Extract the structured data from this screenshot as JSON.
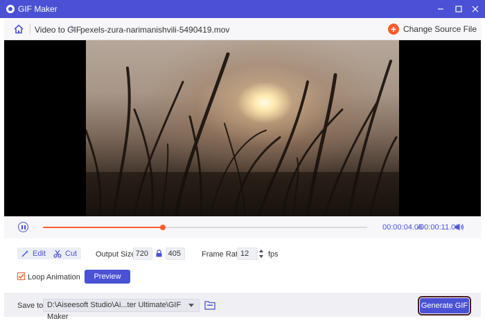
{
  "window": {
    "title": "GIF Maker"
  },
  "nav": {
    "crumb_root": "Video to GIF",
    "crumb_file": "pexels-zura-narimanishvili-5490419.mov",
    "change_source_label": "Change Source File"
  },
  "player": {
    "current_time": "00:00:04.06",
    "total_time": "/00:00:11.06",
    "progress_fraction": 0.37
  },
  "options": {
    "edit_label": "Edit",
    "cut_label": "Cut",
    "output_size_label": "Output Size:",
    "width_value": "720",
    "height_value": "405",
    "frame_rate_label": "Frame Rate:",
    "frame_rate_value": "12",
    "fps_unit": "fps",
    "loop_label": "Loop Animation",
    "loop_checked": true,
    "preview_label": "Preview"
  },
  "save": {
    "label": "Save to:",
    "path": "D:\\Aiseesoft Studio\\Ai...ter Ultimate\\GIF Maker",
    "generate_label": "Generate GIF"
  },
  "colors": {
    "accent": "#4a51d4",
    "progress": "#ff5b2e",
    "title_bar": "#4a51d4"
  },
  "icons": [
    "app-logo-icon",
    "minimize-icon",
    "maximize-icon",
    "close-icon",
    "home-icon",
    "chevron-right-icon",
    "plus-circle-icon",
    "pause-icon",
    "volume-icon",
    "edit-wand-icon",
    "scissors-icon",
    "lock-icon",
    "spinner-arrows-icon",
    "checkmark-icon",
    "dropdown-arrow-icon",
    "folder-icon"
  ]
}
